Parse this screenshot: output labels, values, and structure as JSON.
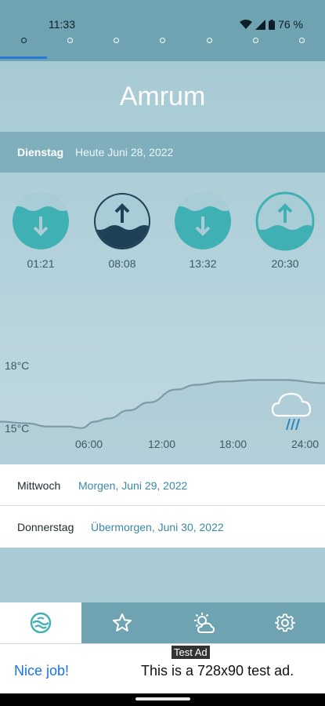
{
  "status": {
    "time": "11:33",
    "battery": "76 %"
  },
  "pager": {
    "pages": 7,
    "active_index": 0
  },
  "city": "Amrum",
  "today": {
    "weekday": "Dienstag",
    "date": "Heute Juni 28, 2022"
  },
  "tides": [
    {
      "time": "01:21",
      "direction": "down",
      "highlighted": false
    },
    {
      "time": "08:08",
      "direction": "up",
      "highlighted": true
    },
    {
      "time": "13:32",
      "direction": "down",
      "highlighted": false
    },
    {
      "time": "20:30",
      "direction": "up",
      "highlighted": false
    }
  ],
  "chart_data": {
    "type": "line",
    "x_ticks": [
      "06:00",
      "12:00",
      "18:00",
      "24:00"
    ],
    "y_ticks": [
      "18°C",
      "15°C"
    ],
    "weather_icon": "cloud-rain-icon",
    "series": [
      {
        "values": [
          15.6,
          15.5,
          15.3,
          15.3,
          15.2,
          15.6,
          15.8,
          16.3,
          16.8,
          17.6,
          17.9,
          18.1,
          18.2,
          18.2,
          18.0
        ]
      }
    ],
    "x": [
      0,
      2,
      3.5,
      5,
      6,
      7,
      8,
      9.5,
      11,
      13,
      14.5,
      16.5,
      19,
      21,
      24
    ],
    "ylim": [
      14.6,
      19.0
    ],
    "xlim": [
      0,
      24
    ]
  },
  "days": [
    {
      "weekday": "Mittwoch",
      "date": "Morgen,  Juni 29, 2022"
    },
    {
      "weekday": "Donnerstag",
      "date": "Übermorgen,  Juni 30, 2022"
    }
  ],
  "nav": [
    {
      "icon": "tide-wave-icon",
      "active": true
    },
    {
      "icon": "star-icon",
      "active": false
    },
    {
      "icon": "sun-cloud-icon",
      "active": false
    },
    {
      "icon": "gear-icon",
      "active": false
    }
  ],
  "ad": {
    "label": "Test Ad",
    "cta": "Nice job!",
    "message": "This is a 728x90 test ad."
  },
  "colors": {
    "accent": "#3fb0b4",
    "dark": "#1e4158",
    "header": "#6fa3b1",
    "link": "#3a87a8"
  }
}
